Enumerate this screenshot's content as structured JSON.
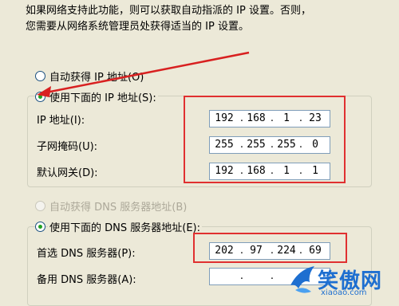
{
  "description": {
    "line1": "如果网络支持此功能，则可以获取自动指派的 IP 设置。否则，",
    "line2": "您需要从网络系统管理员处获得适当的 IP 设置。"
  },
  "ip_settings": {
    "auto_label": "自动获得 IP 地址(O)",
    "manual_label": "使用下面的 IP 地址(S):",
    "manual_selected": true,
    "fields": [
      {
        "label": "IP 地址(I):",
        "octets": [
          "192",
          "168",
          "1",
          "23"
        ]
      },
      {
        "label": "子网掩码(U):",
        "octets": [
          "255",
          "255",
          "255",
          "0"
        ]
      },
      {
        "label": "默认网关(D):",
        "octets": [
          "192",
          "168",
          "1",
          "1"
        ]
      }
    ]
  },
  "dns_settings": {
    "auto_label": "自动获得 DNS 服务器地址(B)",
    "manual_label": "使用下面的 DNS 服务器地址(E):",
    "manual_selected": true,
    "fields": [
      {
        "label": "首选 DNS 服务器(P):",
        "octets": [
          "202",
          "97",
          "224",
          "69"
        ]
      },
      {
        "label": "备用 DNS 服务器(A):",
        "octets": [
          "",
          "",
          "",
          ""
        ]
      }
    ]
  },
  "watermark": {
    "text": "笑傲网",
    "sub": "xiaoao.com"
  },
  "colors": {
    "highlight": "#e03030",
    "arrow": "#d82020",
    "radio_dot": "#21a121"
  }
}
